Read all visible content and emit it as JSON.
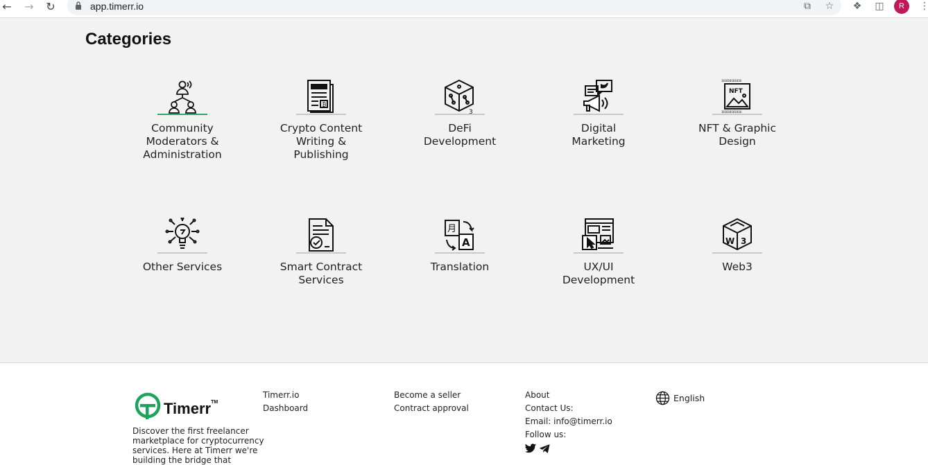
{
  "browser": {
    "url": "app.timerr.io",
    "profile_initial": "R"
  },
  "categories": {
    "title": "Categories",
    "items": [
      {
        "label": "Community\nModerators &\nAdministration",
        "icon": "community-icon",
        "active": true
      },
      {
        "label": "Crypto Content\nWriting &\nPublishing",
        "icon": "document-icon"
      },
      {
        "label": "DeFi\nDevelopment",
        "icon": "defi-cube-icon"
      },
      {
        "label": "Digital\nMarketing",
        "icon": "megaphone-icon"
      },
      {
        "label": "NFT & Graphic\nDesign",
        "icon": "nft-image-icon"
      },
      {
        "label": "Other Services",
        "icon": "lightbulb-icon"
      },
      {
        "label": "Smart Contract\nServices",
        "icon": "contract-check-icon"
      },
      {
        "label": "Translation",
        "icon": "translation-icon"
      },
      {
        "label": "UX/UI\nDevelopment",
        "icon": "ui-design-icon"
      },
      {
        "label": "Web3",
        "icon": "web3-cube-icon"
      }
    ]
  },
  "footer": {
    "brand": "Timerr",
    "brand_tm": "TM",
    "tagline": "Discover the first freelancer marketplace for cryptocurrency services. Here at Timerr we're building the bridge that connects",
    "col1": [
      "Timerr.io",
      "Dashboard"
    ],
    "col2": [
      "Become a seller",
      "Contract approval"
    ],
    "col3": [
      "About",
      "Contact Us:",
      "Email: info@timerr.io",
      "Follow us:"
    ],
    "language": "English",
    "brand_color": "#1fa35c"
  }
}
